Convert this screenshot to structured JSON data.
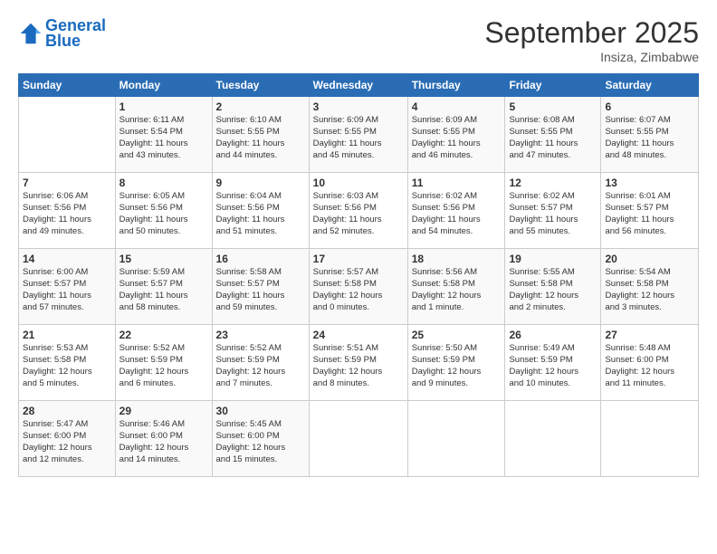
{
  "header": {
    "logo_line1": "General",
    "logo_line2": "Blue",
    "month": "September 2025",
    "location": "Insiza, Zimbabwe"
  },
  "weekdays": [
    "Sunday",
    "Monday",
    "Tuesday",
    "Wednesday",
    "Thursday",
    "Friday",
    "Saturday"
  ],
  "weeks": [
    [
      {
        "day": "",
        "info": ""
      },
      {
        "day": "1",
        "info": "Sunrise: 6:11 AM\nSunset: 5:54 PM\nDaylight: 11 hours\nand 43 minutes."
      },
      {
        "day": "2",
        "info": "Sunrise: 6:10 AM\nSunset: 5:55 PM\nDaylight: 11 hours\nand 44 minutes."
      },
      {
        "day": "3",
        "info": "Sunrise: 6:09 AM\nSunset: 5:55 PM\nDaylight: 11 hours\nand 45 minutes."
      },
      {
        "day": "4",
        "info": "Sunrise: 6:09 AM\nSunset: 5:55 PM\nDaylight: 11 hours\nand 46 minutes."
      },
      {
        "day": "5",
        "info": "Sunrise: 6:08 AM\nSunset: 5:55 PM\nDaylight: 11 hours\nand 47 minutes."
      },
      {
        "day": "6",
        "info": "Sunrise: 6:07 AM\nSunset: 5:55 PM\nDaylight: 11 hours\nand 48 minutes."
      }
    ],
    [
      {
        "day": "7",
        "info": "Sunrise: 6:06 AM\nSunset: 5:56 PM\nDaylight: 11 hours\nand 49 minutes."
      },
      {
        "day": "8",
        "info": "Sunrise: 6:05 AM\nSunset: 5:56 PM\nDaylight: 11 hours\nand 50 minutes."
      },
      {
        "day": "9",
        "info": "Sunrise: 6:04 AM\nSunset: 5:56 PM\nDaylight: 11 hours\nand 51 minutes."
      },
      {
        "day": "10",
        "info": "Sunrise: 6:03 AM\nSunset: 5:56 PM\nDaylight: 11 hours\nand 52 minutes."
      },
      {
        "day": "11",
        "info": "Sunrise: 6:02 AM\nSunset: 5:56 PM\nDaylight: 11 hours\nand 54 minutes."
      },
      {
        "day": "12",
        "info": "Sunrise: 6:02 AM\nSunset: 5:57 PM\nDaylight: 11 hours\nand 55 minutes."
      },
      {
        "day": "13",
        "info": "Sunrise: 6:01 AM\nSunset: 5:57 PM\nDaylight: 11 hours\nand 56 minutes."
      }
    ],
    [
      {
        "day": "14",
        "info": "Sunrise: 6:00 AM\nSunset: 5:57 PM\nDaylight: 11 hours\nand 57 minutes."
      },
      {
        "day": "15",
        "info": "Sunrise: 5:59 AM\nSunset: 5:57 PM\nDaylight: 11 hours\nand 58 minutes."
      },
      {
        "day": "16",
        "info": "Sunrise: 5:58 AM\nSunset: 5:57 PM\nDaylight: 11 hours\nand 59 minutes."
      },
      {
        "day": "17",
        "info": "Sunrise: 5:57 AM\nSunset: 5:58 PM\nDaylight: 12 hours\nand 0 minutes."
      },
      {
        "day": "18",
        "info": "Sunrise: 5:56 AM\nSunset: 5:58 PM\nDaylight: 12 hours\nand 1 minute."
      },
      {
        "day": "19",
        "info": "Sunrise: 5:55 AM\nSunset: 5:58 PM\nDaylight: 12 hours\nand 2 minutes."
      },
      {
        "day": "20",
        "info": "Sunrise: 5:54 AM\nSunset: 5:58 PM\nDaylight: 12 hours\nand 3 minutes."
      }
    ],
    [
      {
        "day": "21",
        "info": "Sunrise: 5:53 AM\nSunset: 5:58 PM\nDaylight: 12 hours\nand 5 minutes."
      },
      {
        "day": "22",
        "info": "Sunrise: 5:52 AM\nSunset: 5:59 PM\nDaylight: 12 hours\nand 6 minutes."
      },
      {
        "day": "23",
        "info": "Sunrise: 5:52 AM\nSunset: 5:59 PM\nDaylight: 12 hours\nand 7 minutes."
      },
      {
        "day": "24",
        "info": "Sunrise: 5:51 AM\nSunset: 5:59 PM\nDaylight: 12 hours\nand 8 minutes."
      },
      {
        "day": "25",
        "info": "Sunrise: 5:50 AM\nSunset: 5:59 PM\nDaylight: 12 hours\nand 9 minutes."
      },
      {
        "day": "26",
        "info": "Sunrise: 5:49 AM\nSunset: 5:59 PM\nDaylight: 12 hours\nand 10 minutes."
      },
      {
        "day": "27",
        "info": "Sunrise: 5:48 AM\nSunset: 6:00 PM\nDaylight: 12 hours\nand 11 minutes."
      }
    ],
    [
      {
        "day": "28",
        "info": "Sunrise: 5:47 AM\nSunset: 6:00 PM\nDaylight: 12 hours\nand 12 minutes."
      },
      {
        "day": "29",
        "info": "Sunrise: 5:46 AM\nSunset: 6:00 PM\nDaylight: 12 hours\nand 14 minutes."
      },
      {
        "day": "30",
        "info": "Sunrise: 5:45 AM\nSunset: 6:00 PM\nDaylight: 12 hours\nand 15 minutes."
      },
      {
        "day": "",
        "info": ""
      },
      {
        "day": "",
        "info": ""
      },
      {
        "day": "",
        "info": ""
      },
      {
        "day": "",
        "info": ""
      }
    ]
  ]
}
